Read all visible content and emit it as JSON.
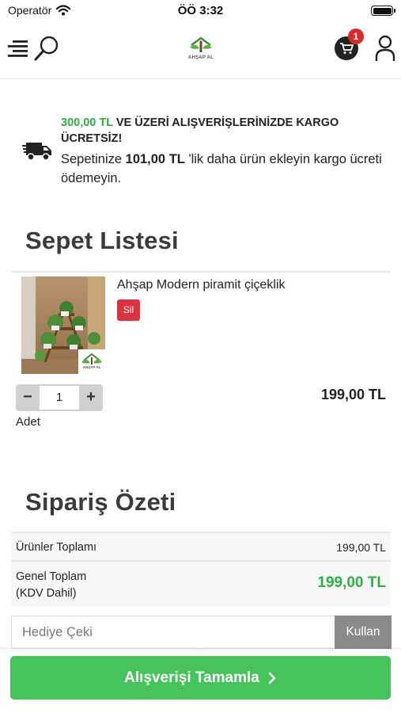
{
  "status_bar": {
    "carrier": "Operatör",
    "time": "ÖÖ 3:32"
  },
  "header": {
    "logo_text": "AHŞAP AL",
    "cart_count": "1"
  },
  "shipping_notice": {
    "threshold": "300,00 TL",
    "title_rest": "VE ÜZERİ ALIŞVERİŞLERİNİZDE KARGO ÜCRETSİZ!",
    "text_before": "Sepetinize ",
    "missing_amount": "101,00 TL",
    "text_after": " 'lik daha ürün ekleyin kargo ücreti ödemeyin."
  },
  "cart": {
    "title": "Sepet Listesi",
    "items": [
      {
        "name": "Ahşap Modern piramit çiçeklik",
        "delete_label": "Sil",
        "quantity": "1",
        "quantity_label": "Adet",
        "price": "199,00 TL",
        "image_logo_text": "AHŞAP AL"
      }
    ]
  },
  "summary": {
    "title": "Sipariş Özeti",
    "subtotal_label": "Ürünler Toplamı",
    "subtotal_value": "199,00 TL",
    "total_label_1": "Genel Toplam",
    "total_label_2": "(KDV Dahil)",
    "total_value": "199,00 TL"
  },
  "gift_card": {
    "placeholder": "Hediye Çeki",
    "value": "",
    "apply_label": "Kullan"
  },
  "checkout": {
    "label": "Alışverişi Tamamla"
  },
  "colors": {
    "accent_green": "#2eaf44",
    "button_green": "#46c35a",
    "delete_red": "#d9333f",
    "badge_red": "#d92b2b"
  }
}
